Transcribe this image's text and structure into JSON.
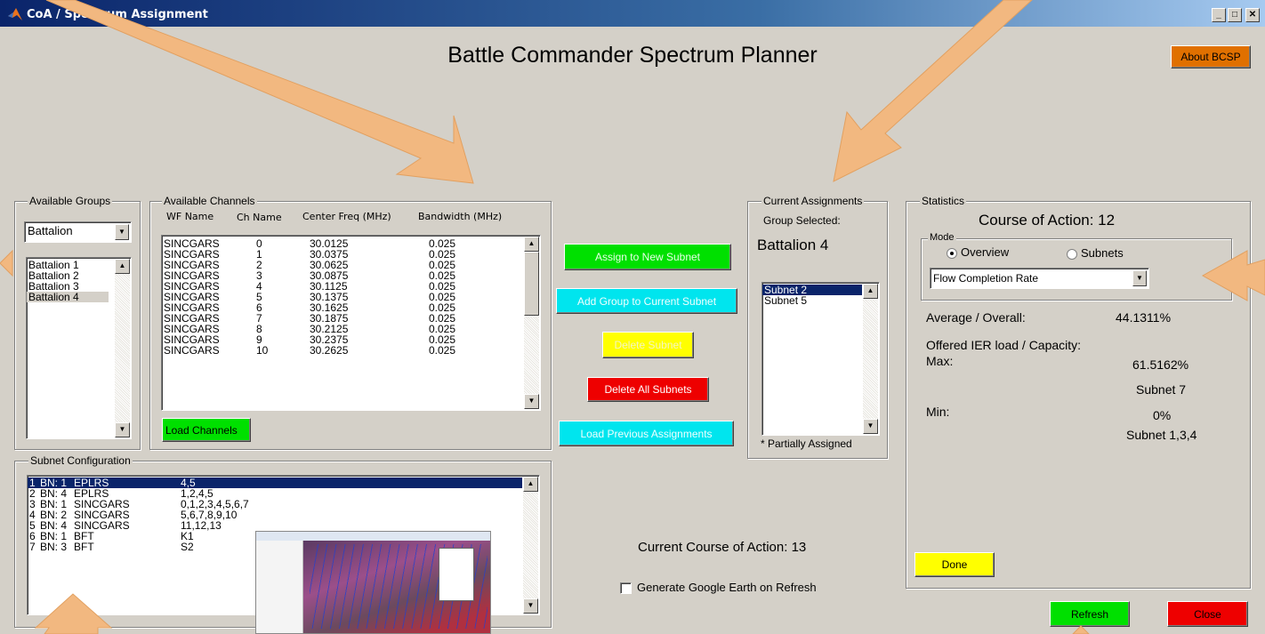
{
  "window": {
    "title": "CoA / Spectrum Assignment"
  },
  "app": {
    "title": "Battle Commander Spectrum Planner",
    "about_label": "About BCSP"
  },
  "available_groups": {
    "legend": "Available Groups",
    "dropdown_value": "Battalion",
    "items": [
      "Battalion 1",
      "Battalion 2",
      "Battalion 3",
      "Battalion 4"
    ],
    "selected_index": 3
  },
  "available_channels": {
    "legend": "Available Channels",
    "headers": {
      "wf": "WF Name",
      "ch": "Ch Name",
      "freq": "Center Freq (MHz)",
      "bw": "Bandwidth (MHz)"
    },
    "rows": [
      {
        "wf": "SINCGARS",
        "ch": "0",
        "freq": "30.0125",
        "bw": "0.025"
      },
      {
        "wf": "SINCGARS",
        "ch": "1",
        "freq": "30.0375",
        "bw": "0.025"
      },
      {
        "wf": "SINCGARS",
        "ch": "2",
        "freq": "30.0625",
        "bw": "0.025"
      },
      {
        "wf": "SINCGARS",
        "ch": "3",
        "freq": "30.0875",
        "bw": "0.025"
      },
      {
        "wf": "SINCGARS",
        "ch": "4",
        "freq": "30.1125",
        "bw": "0.025"
      },
      {
        "wf": "SINCGARS",
        "ch": "5",
        "freq": "30.1375",
        "bw": "0.025"
      },
      {
        "wf": "SINCGARS",
        "ch": "6",
        "freq": "30.1625",
        "bw": "0.025"
      },
      {
        "wf": "SINCGARS",
        "ch": "7",
        "freq": "30.1875",
        "bw": "0.025"
      },
      {
        "wf": "SINCGARS",
        "ch": "8",
        "freq": "30.2125",
        "bw": "0.025"
      },
      {
        "wf": "SINCGARS",
        "ch": "9",
        "freq": "30.2375",
        "bw": "0.025"
      },
      {
        "wf": "SINCGARS",
        "ch": "10",
        "freq": "30.2625",
        "bw": "0.025"
      }
    ],
    "load_label": "Load Channels"
  },
  "actions": {
    "assign_new": "Assign to New Subnet",
    "add_group": "Add Group to Current Subnet",
    "delete_subnet": "Delete Subnet",
    "delete_all": "Delete All Subnets",
    "load_previous": "Load Previous Assignments"
  },
  "current_assignments": {
    "legend": "Current Assignments",
    "group_selected_label": "Group Selected:",
    "group_selected_value": "Battalion 4",
    "items": [
      "Subnet 2",
      "Subnet 5"
    ],
    "selected_index": 0,
    "footnote": "* Partially Assigned"
  },
  "statistics": {
    "legend": "Statistics",
    "coa_title": "Course of Action: 12",
    "mode_legend": "Mode",
    "mode_options": [
      "Overview",
      "Subnets"
    ],
    "mode_selected": "Overview",
    "metric_value": "Flow Completion Rate",
    "average_label": "Average / Overall:",
    "average_value": "44.1311%",
    "offered_label": "Offered IER load / Capacity:",
    "max_label": "Max:",
    "max_value": "61.5162%",
    "max_subnet": "Subnet 7",
    "min_label": "Min:",
    "min_value": "0%",
    "min_subnet": "Subnet 1,3,4",
    "done_label": "Done"
  },
  "subnet_configuration": {
    "legend": "Subnet Configuration",
    "rows": [
      {
        "n": "1",
        "bn": "BN: 1",
        "wf": "EPLRS",
        "ch": "4,5"
      },
      {
        "n": "2",
        "bn": "BN: 4",
        "wf": "EPLRS",
        "ch": "1,2,4,5"
      },
      {
        "n": "3",
        "bn": "BN: 1",
        "wf": "SINCGARS",
        "ch": "0,1,2,3,4,5,6,7"
      },
      {
        "n": "4",
        "bn": "BN: 2",
        "wf": "SINCGARS",
        "ch": "5,6,7,8,9,10"
      },
      {
        "n": "5",
        "bn": "BN: 4",
        "wf": "SINCGARS",
        "ch": "11,12,13"
      },
      {
        "n": "6",
        "bn": "BN: 1",
        "wf": "BFT",
        "ch": "K1"
      },
      {
        "n": "7",
        "bn": "BN: 3",
        "wf": "BFT",
        "ch": "S2"
      }
    ],
    "selected_index": 0
  },
  "footer": {
    "current_coa": "Current Course of Action: 13",
    "google_earth_label": "Generate Google Earth on Refresh",
    "google_earth_checked": false,
    "refresh_label": "Refresh",
    "close_label": "Close"
  },
  "colors": {
    "window_bg": "#d4d0c8",
    "titlebar": "#0a246a",
    "selection": "#0a246a",
    "green_button": "#00e000",
    "cyan_button": "#00e5ee",
    "yellow_button": "#ffff00",
    "red_button": "#ee0000",
    "orange_button": "#e07000",
    "annotation_arrow": "#f2b880"
  }
}
